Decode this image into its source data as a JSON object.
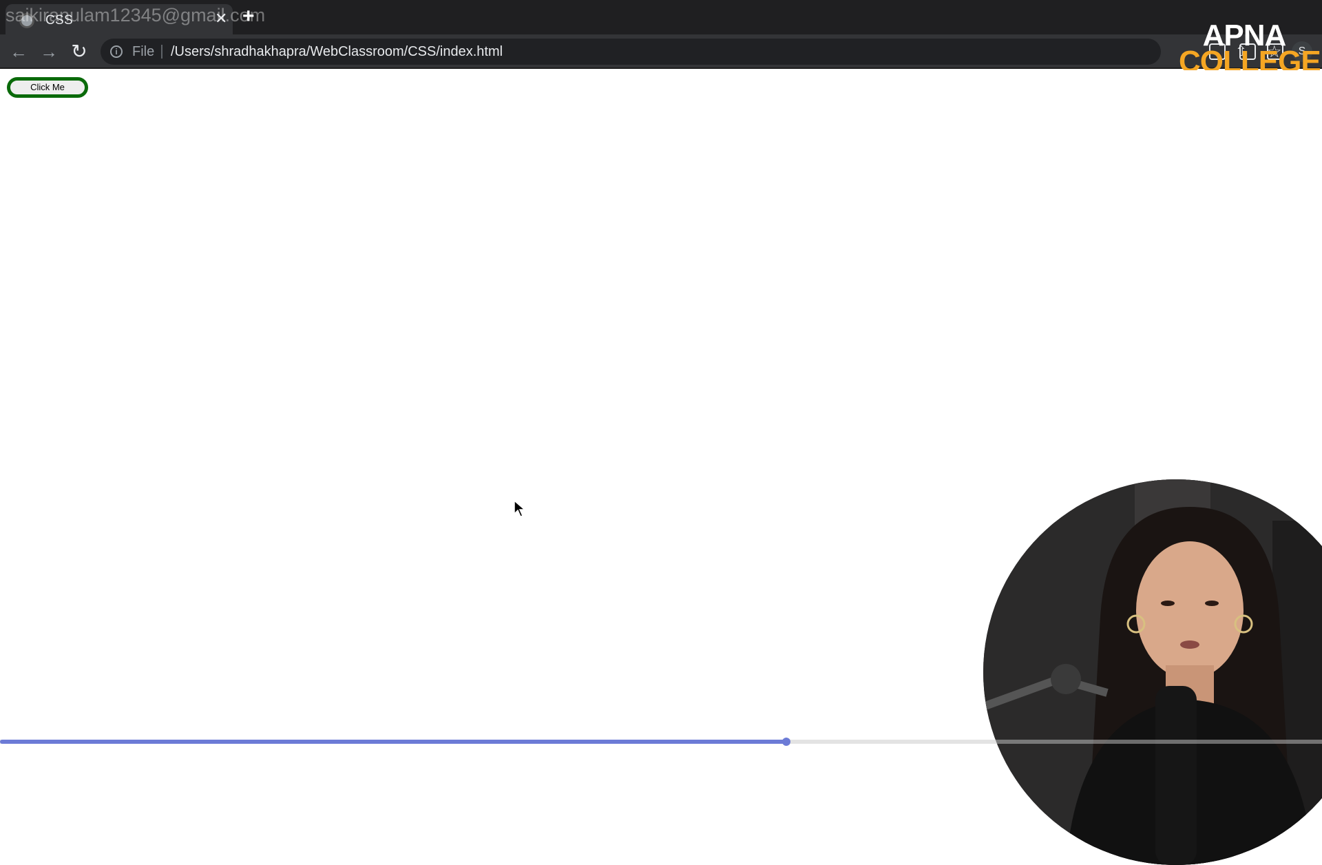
{
  "browser": {
    "tab_title": "CSS",
    "tab_close_glyph": "✕",
    "new_tab_glyph": "+",
    "watermark_email": "saikiranulam12345@gmail.com",
    "address_scheme": "File",
    "address_url": "/Users/shradhakhapra/WebClassroom/CSS/index.html",
    "profile_initial": "S",
    "icons": {
      "back": "back-arrow-icon",
      "forward": "forward-arrow-icon",
      "reload": "reload-icon",
      "info": "info-icon",
      "share": "share-icon",
      "bookmark": "star-icon"
    }
  },
  "brand": {
    "line1": "APNA",
    "line2": "COLLEGE",
    "line1_color": "#ffffff",
    "line2_color": "#f5a623"
  },
  "page": {
    "button_label": "Click Me",
    "button_border_color": "#0a6a0a"
  },
  "video": {
    "progress_fraction": 0.595
  }
}
